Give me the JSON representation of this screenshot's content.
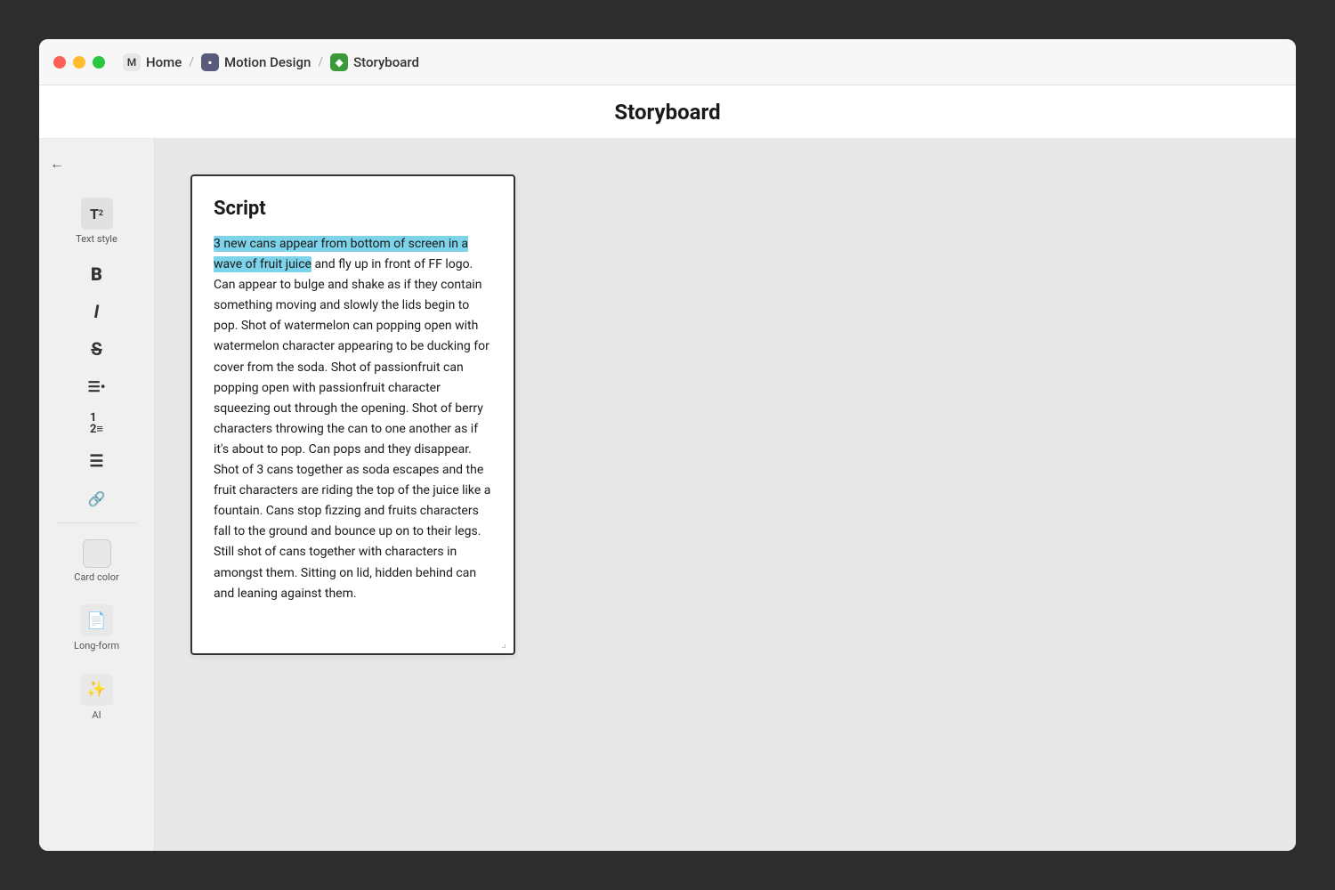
{
  "window": {
    "title": "Storyboard"
  },
  "titlebar": {
    "home_label": "Home",
    "motion_label": "Motion Design",
    "storyboard_label": "Storyboard",
    "separator": "/"
  },
  "page": {
    "title": "Storyboard"
  },
  "sidebar": {
    "back_icon": "←",
    "tools": [
      {
        "id": "text-style",
        "icon": "T₂",
        "label": "Text style"
      },
      {
        "id": "bold",
        "icon": "B",
        "label": ""
      },
      {
        "id": "italic",
        "icon": "I",
        "label": ""
      },
      {
        "id": "strikethrough",
        "icon": "S̶",
        "label": ""
      },
      {
        "id": "unordered-list",
        "icon": "≡•",
        "label": ""
      },
      {
        "id": "ordered-list",
        "icon": "≡#",
        "label": ""
      },
      {
        "id": "align",
        "icon": "≡",
        "label": ""
      },
      {
        "id": "link",
        "icon": "🔗",
        "label": ""
      }
    ],
    "card_color_label": "Card color",
    "long_form_label": "Long-form",
    "ai_label": "AI"
  },
  "script": {
    "title": "Script",
    "highlighted_text": "3 new cans appear from bottom of screen in a wave of fruit juice",
    "body_text": " and fly up in front of FF logo. Can appear to bulge and shake as if they contain something moving and slowly the lids begin to pop. Shot of watermelon can popping open with watermelon character appearing to be ducking for cover from the soda. Shot of passionfruit can popping open with passionfruit character squeezing out through the opening. Shot of berry characters throwing the can to one another as if it's about to pop. Can pops and they disappear. Shot of 3 cans together as soda escapes and the fruit characters are riding the top of the juice like a fountain. Cans stop fizzing and fruits characters fall to the ground and bounce up on to their legs. Still shot of cans together with characters in amongst them. Sitting on lid, hidden behind can and leaning against them."
  }
}
